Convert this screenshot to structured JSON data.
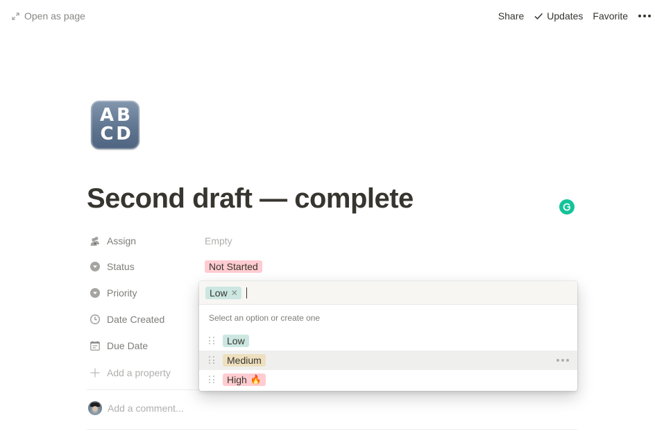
{
  "topbar": {
    "open_as_page": "Open as page",
    "share": "Share",
    "updates": "Updates",
    "favorite": "Favorite"
  },
  "page": {
    "icon_letters": [
      "A",
      "B",
      "C",
      "D"
    ],
    "title": "Second draft — complete"
  },
  "properties": [
    {
      "name": "Assign",
      "icon": "person-icon",
      "value": "Empty"
    },
    {
      "name": "Status",
      "icon": "select-icon",
      "value": "Not Started",
      "color": "#ffccd1"
    },
    {
      "name": "Priority",
      "icon": "select-icon"
    },
    {
      "name": "Date Created",
      "icon": "clock-icon"
    },
    {
      "name": "Due Date",
      "icon": "calendar-icon"
    }
  ],
  "add_property": "Add a property",
  "comment": {
    "placeholder": "Add a comment..."
  },
  "priority_popup": {
    "selected": "Low",
    "hint": "Select an option or create one",
    "options": [
      {
        "label": "Low",
        "color": "#cce7e1"
      },
      {
        "label": "Medium",
        "color": "#eee0bf",
        "hovered": true
      },
      {
        "label": "High",
        "emoji": "🔥",
        "color": "#ffccd1"
      }
    ]
  }
}
